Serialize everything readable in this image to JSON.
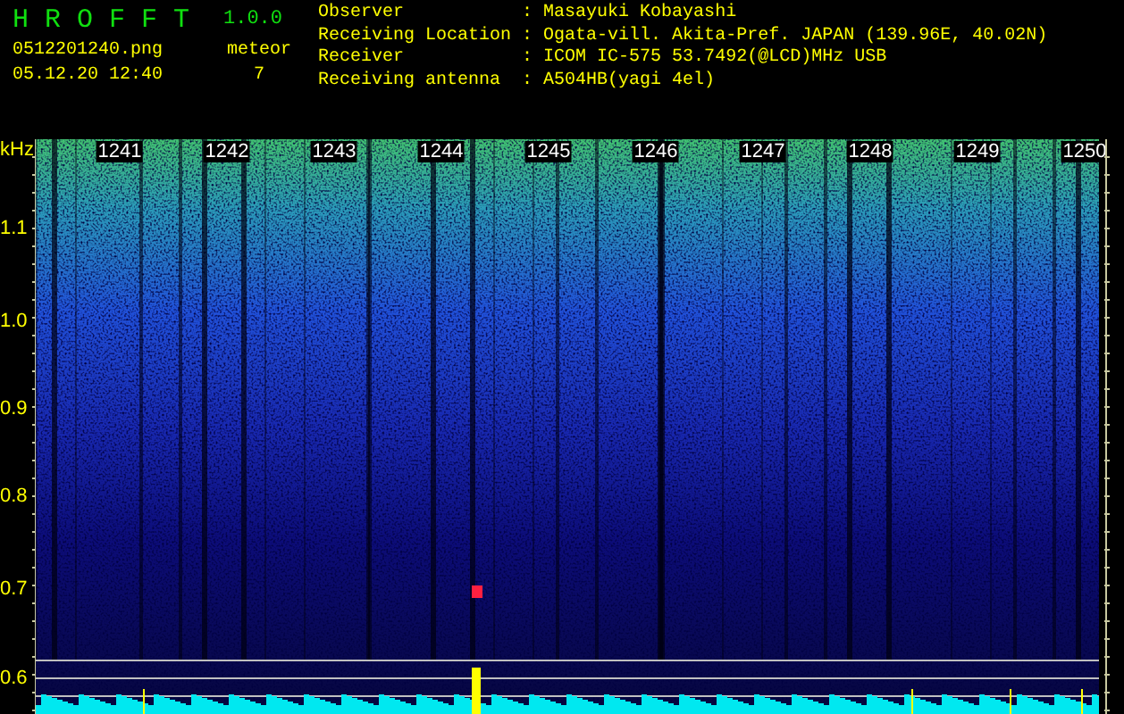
{
  "app": {
    "title": "H R O F F T",
    "version": "1.0.0"
  },
  "file": {
    "name": "0512201240.png",
    "datetime": "05.12.20 12:40"
  },
  "counter": {
    "label": "meteor",
    "value": "7"
  },
  "station": [
    {
      "label": "Observer",
      "separator": ":",
      "value": "Masayuki Kobayashi"
    },
    {
      "label": "Receiving Location",
      "separator": ":",
      "value": "Ogata-vill. Akita-Pref. JAPAN (139.96E, 40.02N)"
    },
    {
      "label": "Receiver",
      "separator": ":",
      "value": "ICOM IC-575 53.7492(@LCD)MHz USB"
    },
    {
      "label": "Receiving antenna",
      "separator": ":",
      "value": "A504HB(yagi 4el)"
    }
  ],
  "spectrogram": {
    "y_unit": "kHz",
    "y_ticks": [
      "1.1",
      "1.0",
      "0.9",
      "0.8",
      "0.7",
      "0.6"
    ],
    "time_marks": [
      "1241",
      "1242",
      "1243",
      "1244",
      "1245",
      "1246",
      "1247",
      "1248",
      "1249",
      "1250"
    ]
  }
}
